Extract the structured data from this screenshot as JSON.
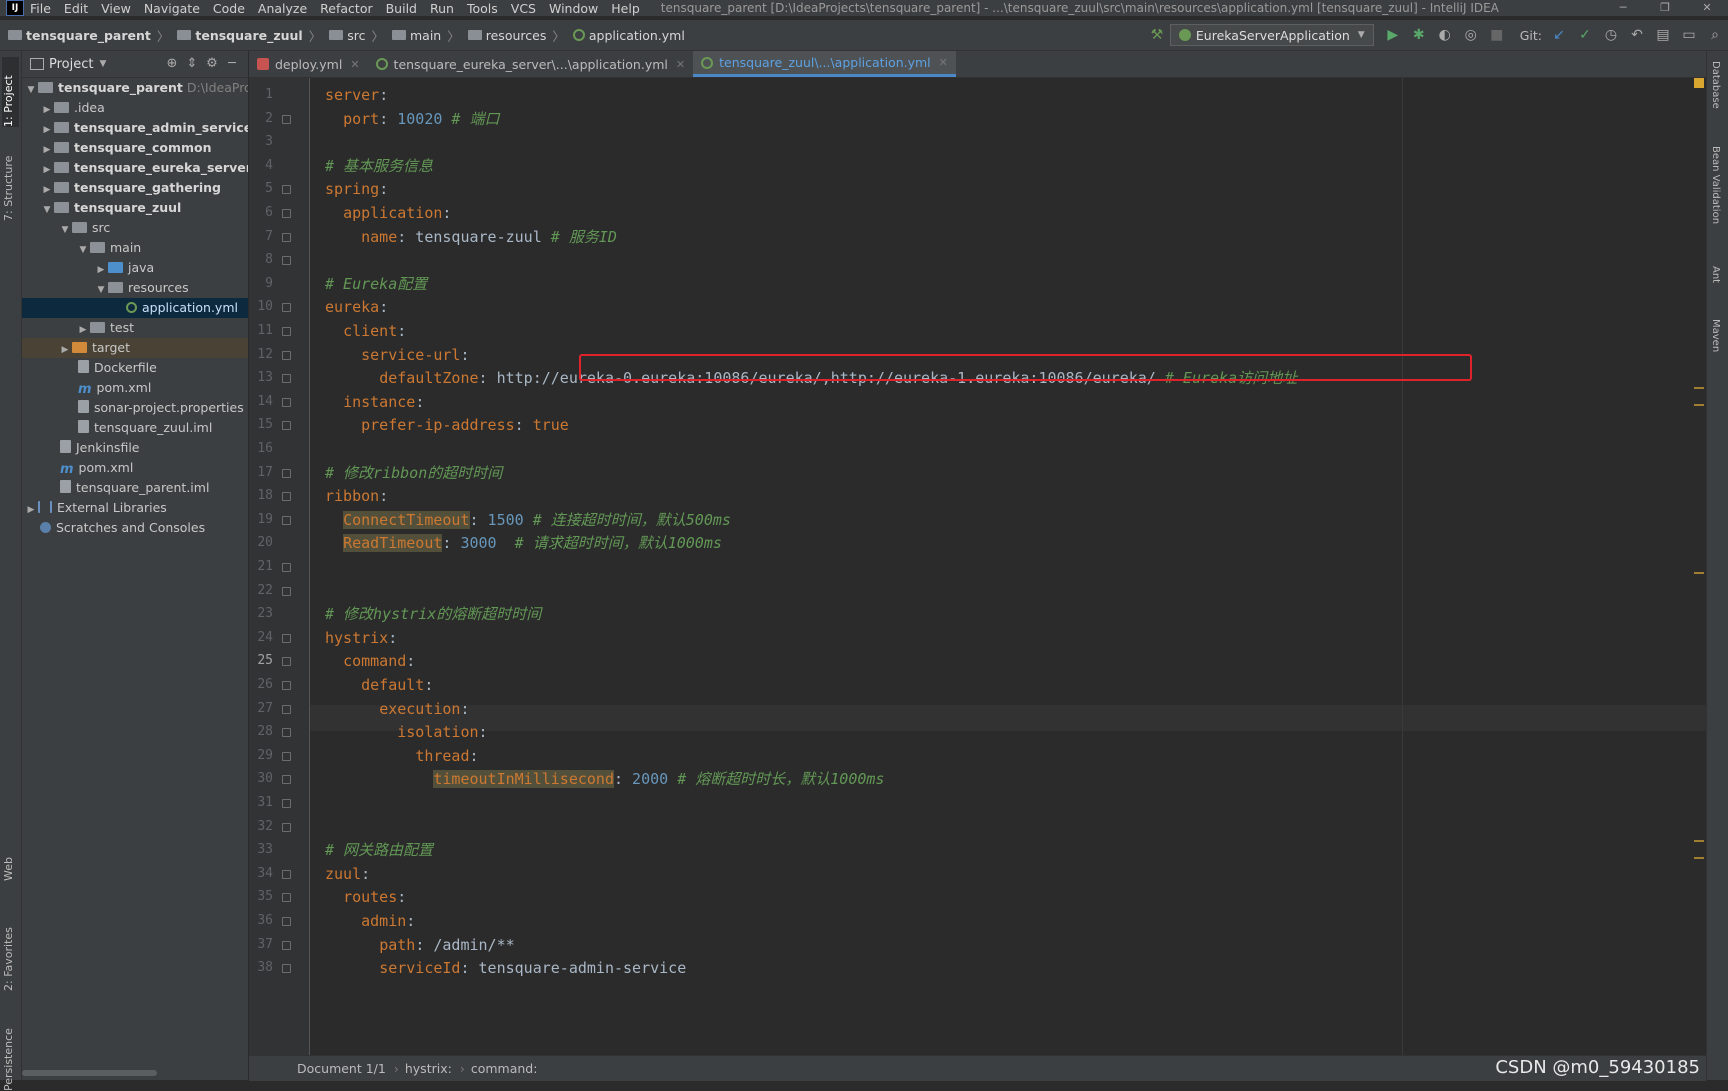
{
  "menubar": {
    "items": [
      "File",
      "Edit",
      "View",
      "Navigate",
      "Code",
      "Analyze",
      "Refactor",
      "Build",
      "Run",
      "Tools",
      "VCS",
      "Window",
      "Help"
    ],
    "window_title": "tensquare_parent [D:\\IdeaProjects\\tensquare_parent] - ...\\tensquare_zuul\\src\\main\\resources\\application.yml [tensquare_zuul] - IntelliJ IDEA"
  },
  "breadcrumb": {
    "items": [
      "tensquare_parent",
      "tensquare_zuul",
      "src",
      "main",
      "resources",
      "application.yml"
    ]
  },
  "toolbar": {
    "run_config": "EurekaServerApplication",
    "git_label": "Git:"
  },
  "left_tabs": {
    "project": "1: Project",
    "structure": "7: Structure",
    "web": "Web",
    "favorites": "2: Favorites",
    "persistence": "Persistence"
  },
  "right_tabs": {
    "database": "Database",
    "bean": "Bean Validation",
    "ant": "Ant",
    "maven": "Maven"
  },
  "project_panel": {
    "title": "Project",
    "tree": [
      {
        "label": "tensquare_parent",
        "hint": "D:\\IdeaProje",
        "bold": true
      },
      {
        "label": ".idea"
      },
      {
        "label": "tensquare_admin_service",
        "bold": true
      },
      {
        "label": "tensquare_common",
        "bold": true
      },
      {
        "label": "tensquare_eureka_server",
        "bold": true
      },
      {
        "label": "tensquare_gathering",
        "bold": true
      },
      {
        "label": "tensquare_zuul",
        "bold": true
      },
      {
        "label": "src"
      },
      {
        "label": "main"
      },
      {
        "label": "java"
      },
      {
        "label": "resources"
      },
      {
        "label": "application.yml"
      },
      {
        "label": "test"
      },
      {
        "label": "target"
      },
      {
        "label": "Dockerfile"
      },
      {
        "label": "pom.xml"
      },
      {
        "label": "sonar-project.properties"
      },
      {
        "label": "tensquare_zuul.iml"
      },
      {
        "label": "Jenkinsfile"
      },
      {
        "label": "pom.xml"
      },
      {
        "label": "tensquare_parent.iml"
      },
      {
        "label": "External Libraries"
      },
      {
        "label": "Scratches and Consoles"
      }
    ]
  },
  "tabs": [
    {
      "label": "deploy.yml"
    },
    {
      "label": "tensquare_eureka_server\\...\\application.yml"
    },
    {
      "label": "tensquare_zuul\\...\\application.yml"
    }
  ],
  "code_lines": [
    "server:",
    "  port: 10020 # 端口",
    "",
    "# 基本服务信息",
    "spring:",
    "  application:",
    "    name: tensquare-zuul # 服务ID",
    "",
    "# Eureka配置",
    "eureka:",
    "  client:",
    "    service-url:",
    "      defaultZone: http://eureka-0.eureka:10086/eureka/,http://eureka-1.eureka:10086/eureka/ # Eureka访问地址",
    "  instance:",
    "    prefer-ip-address: true",
    "",
    "# 修改ribbon的超时时间",
    "ribbon:",
    "  ConnectTimeout: 1500 # 连接超时时间，默认500ms",
    "  ReadTimeout: 3000  # 请求超时时间，默认1000ms",
    "",
    "",
    "# 修改hystrix的熔断超时时间",
    "hystrix:",
    "  command:",
    "    default:",
    "      execution:",
    "        isolation:",
    "          thread:",
    "            timeoutInMillisecond: 2000 # 熔断超时时长，默认1000ms",
    "",
    "",
    "# 网关路由配置",
    "zuul:",
    "  routes:",
    "    admin:",
    "      path: /admin/**",
    "      serviceId: tensquare-admin-service"
  ],
  "current_line": 25,
  "statusbar": {
    "items": [
      "Document 1/1",
      "hystrix:",
      "command:"
    ]
  },
  "watermark": "CSDN @m0_59430185",
  "colors": {
    "keyword": "#cc7832",
    "number": "#6897bb",
    "comment": "#629755",
    "highlight_box": "#e0232b"
  }
}
